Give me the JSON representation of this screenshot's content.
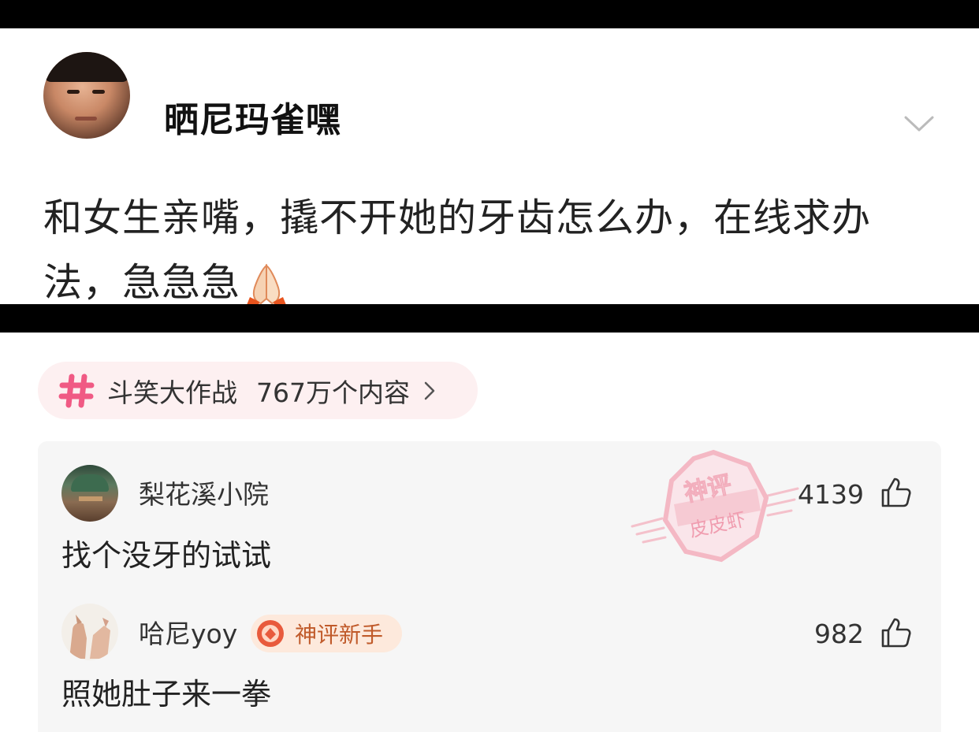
{
  "post": {
    "author": "晒尼玛雀嘿",
    "text": "和女生亲嘴，撬不开她的牙齿怎么办，在线求办法，急急急",
    "emoji_icon": "folded-hands-icon"
  },
  "topic": {
    "label": "斗笑大作战",
    "count": "767万个内容",
    "icon": "hash-icon"
  },
  "comments": [
    {
      "author": "梨花溪小院",
      "text": "找个没牙的试试",
      "likes": "4139",
      "stamp_text": [
        "神评",
        "皮皮虾"
      ]
    },
    {
      "author": "哈尼yoy",
      "badge": "神评新手",
      "text": "照她肚子来一拳",
      "likes": "982"
    }
  ],
  "colors": {
    "accent_pink": "#f05a84",
    "chip_bg": "#fdf0f1",
    "badge_bg": "#fde9dc",
    "badge_text": "#c05a2a",
    "panel_bg": "#f6f6f6"
  }
}
